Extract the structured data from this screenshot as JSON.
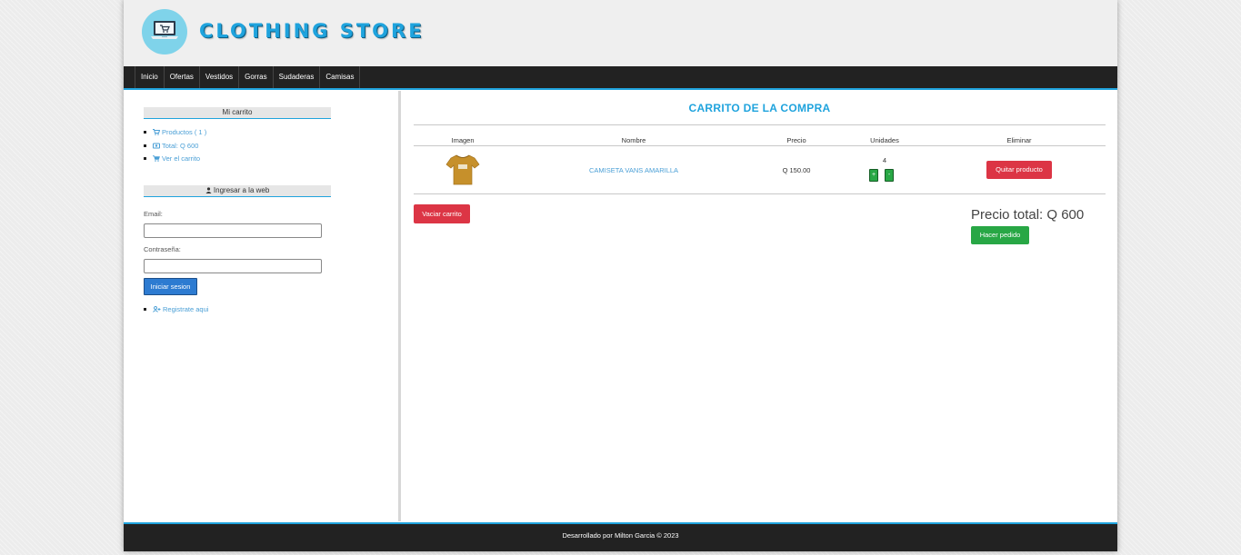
{
  "header": {
    "store_title": "CLOTHING STORE",
    "logo_icon": "laptop-cart-icon"
  },
  "menu": {
    "items": [
      "Inicio",
      "Ofertas",
      "Vestidos",
      "Gorras",
      "Sudaderas",
      "Camisas"
    ]
  },
  "sidebar": {
    "cart_title": "Mi carrito",
    "cart_items": [
      {
        "icon": "cart-icon",
        "label": "Productos ( 1 )"
      },
      {
        "icon": "money-icon",
        "label": "Total: Q 600"
      },
      {
        "icon": "cart-icon",
        "label": "Ver el carrito"
      }
    ],
    "login_title": "Ingresar a la web",
    "email_label": "Email:",
    "email_value": "",
    "password_label": "Contraseña:",
    "password_value": "",
    "login_button": "Iniciar sesion",
    "register_link": "Registrate aqui"
  },
  "cart": {
    "title": "CARRITO DE LA COMPRA",
    "columns": [
      "Imagen",
      "Nombre",
      "Precio",
      "Unidades",
      "Eliminar"
    ],
    "rows": [
      {
        "image_icon": "yellow-tshirt-image",
        "name": "CAMISETA VANS AMARILLA",
        "price": "Q 150.00",
        "units": "4",
        "plus": "+",
        "minus": "-",
        "remove": "Quitar producto"
      }
    ],
    "empty_button": "Vaciar carrito",
    "total_label": "Precio total: Q 600",
    "order_button": "Hacer pedido"
  },
  "footer": {
    "text": "Desarrollado por Milton Garcia © 2023"
  },
  "colors": {
    "accent": "#1fa3dd",
    "dark": "#222222",
    "danger": "#dc3545",
    "success": "#28a745",
    "primary": "#2d7bd1"
  }
}
